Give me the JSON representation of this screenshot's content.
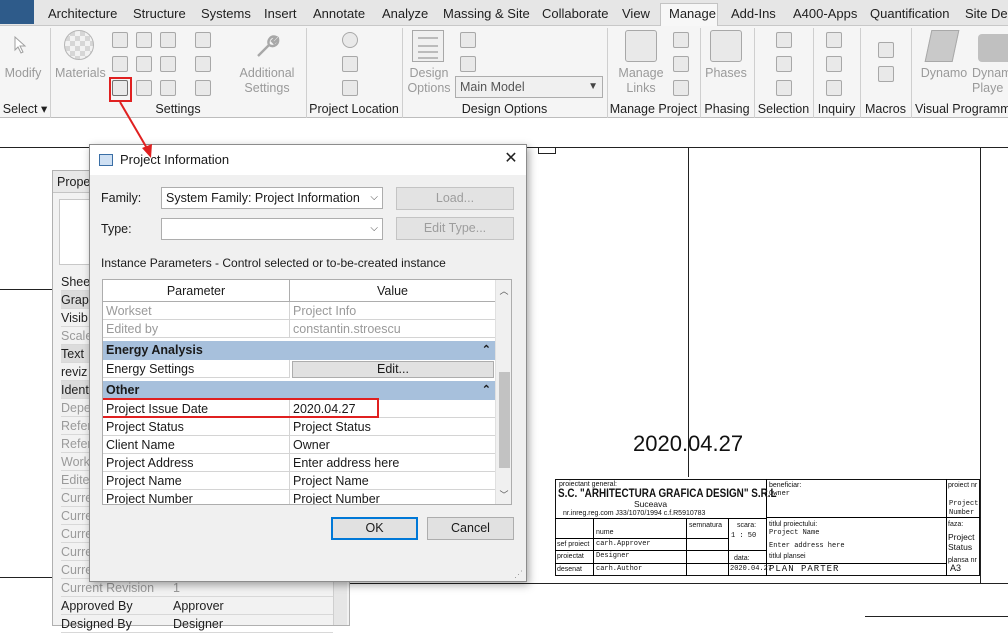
{
  "ribbon": {
    "tabs": [
      "Architecture",
      "Structure",
      "Systems",
      "Insert",
      "Annotate",
      "Analyze",
      "Massing & Site",
      "Collaborate",
      "View",
      "Manage",
      "Add-Ins",
      "A400-Apps",
      "Quantification",
      "Site Des"
    ],
    "active_tab": "Manage",
    "buttons": {
      "modify": "Modify",
      "materials": "Materials",
      "additional_settings_1": "Additional",
      "additional_settings_2": "Settings",
      "design_options_1": "Design",
      "design_options_2": "Options",
      "main_model": "Main Model",
      "manage_links_1": "Manage",
      "manage_links_2": "Links",
      "phases": "Phases",
      "dynamo": "Dynamo",
      "dynamo_player_1": "Dynam",
      "dynamo_player_2": "Playe"
    },
    "panels": {
      "select": "Select",
      "settings": "Settings",
      "project_location": "Project Location",
      "design_options": "Design Options",
      "manage_project": "Manage Project",
      "phasing": "Phasing",
      "selection": "Selection",
      "inquiry": "Inquiry",
      "macros": "Macros",
      "visual_programming": "Visual Programm"
    }
  },
  "properties_palette": {
    "title": "Proper",
    "rows": [
      {
        "label": "Sheet",
        "value": "",
        "type": "plain"
      },
      {
        "label": "Graph",
        "value": "",
        "type": "head"
      },
      {
        "label": "Visib",
        "value": "",
        "type": "plain"
      },
      {
        "label": "Scale",
        "value": "",
        "type": "gray"
      },
      {
        "label": "Text",
        "value": "",
        "type": "head"
      },
      {
        "label": "reviz",
        "value": "",
        "type": "plain"
      },
      {
        "label": "Identi",
        "value": "",
        "type": "head"
      },
      {
        "label": "Depe",
        "value": "",
        "type": "gray"
      },
      {
        "label": "Refer",
        "value": "",
        "type": "gray"
      },
      {
        "label": "Refer",
        "value": "",
        "type": "gray"
      },
      {
        "label": "Work",
        "value": "",
        "type": "gray"
      },
      {
        "label": "Edite",
        "value": "",
        "type": "gray"
      },
      {
        "label": "Curre",
        "value": "",
        "type": "gray"
      },
      {
        "label": "Curre",
        "value": "",
        "type": "gray"
      },
      {
        "label": "Curre",
        "value": "",
        "type": "gray"
      },
      {
        "label": "Curre",
        "value": "",
        "type": "gray"
      },
      {
        "label": "Curre",
        "value": "",
        "type": "gray"
      },
      {
        "label": "Current Revision",
        "value": "1",
        "type": "gray"
      },
      {
        "label": "Approved By",
        "value": "Approver",
        "type": "plain"
      },
      {
        "label": "Designed By",
        "value": "Designer",
        "type": "plain"
      }
    ]
  },
  "dialog": {
    "title": "Project Information",
    "family_label": "Family:",
    "family_value": "System Family: Project Information",
    "type_label": "Type:",
    "type_value": "",
    "load_button": "Load...",
    "edit_type_button": "Edit Type...",
    "instance_caption": "Instance Parameters - Control selected or to-be-created instance",
    "col_parameter": "Parameter",
    "col_value": "Value",
    "rows_top": [
      {
        "param": "Workset",
        "value": "Project Info",
        "gray": true
      },
      {
        "param": "Edited by",
        "value": "constantin.stroescu",
        "gray": true
      }
    ],
    "group_energy": "Energy Analysis",
    "energy_param": "Energy Settings",
    "energy_button": "Edit...",
    "group_other": "Other",
    "rows_other": [
      {
        "param": "Project Issue Date",
        "value": "2020.04.27"
      },
      {
        "param": "Project Status",
        "value": "Project Status"
      },
      {
        "param": "Client Name",
        "value": "Owner"
      },
      {
        "param": "Project Address",
        "value": "Enter address here"
      },
      {
        "param": "Project Name",
        "value": "Project Name"
      },
      {
        "param": "Project Number",
        "value": "Project Number"
      }
    ],
    "ok": "OK",
    "cancel": "Cancel"
  },
  "sheet": {
    "big_date": "2020.04.27",
    "title_block": {
      "proiectant_label": "proiectant general:",
      "firm": "S.C. \"ARHITECTURA GRAFICA DESIGN\" S.R.L",
      "city": "Suceava",
      "reg": "nr.inreg.reg.com J33/1070/1994 c.f.R5910783",
      "nume": "nume",
      "semnatura": "semnatura",
      "scara_label": "scara:",
      "scara_value": "1 : 50",
      "sef_proiect": "sef proiect",
      "sef_name": "carh.Approver",
      "proiectat": "proiectat",
      "proiectat_name": "Designer",
      "desenat": "desenat",
      "desenat_name": "carh.Author",
      "data_label": "data:",
      "data_value": "2020.04.27",
      "beneficiar_label": "beneficiar:",
      "beneficiar_value": "Owner",
      "titlul_proiectului": "titlul proiectului:",
      "proj_name": "Project Name",
      "address": "Enter address here",
      "titlul_plansei": "titlul plansei",
      "plan_title": "PLAN PARTER",
      "proiect_nr_label": "proiect nr",
      "proiect_nr_value_1": "Project",
      "proiect_nr_value_2": "Number",
      "faza_label": "faza:",
      "faza_value_1": "Project",
      "faza_value_2": "Status",
      "plansa_label": "plansa nr",
      "plansa_value": "A3"
    }
  },
  "colors": {
    "highlight_red": "#e02020",
    "group_blue": "#a7c0dc",
    "default_button_border": "#0078d7"
  }
}
